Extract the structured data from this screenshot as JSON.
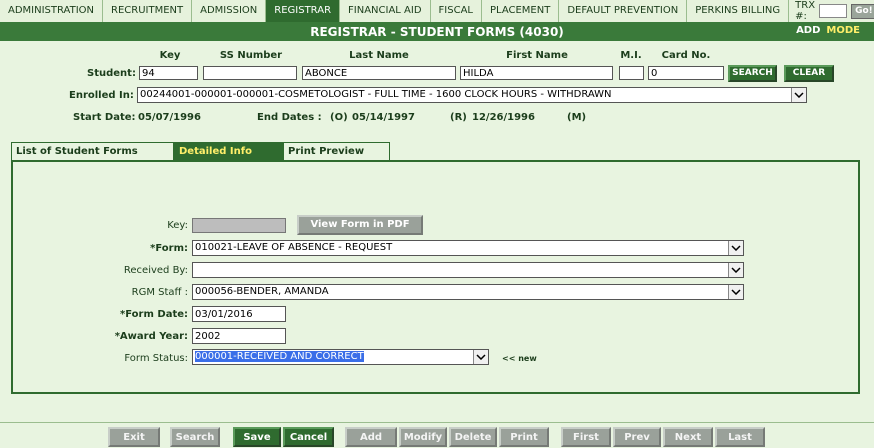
{
  "nav": {
    "items": [
      "ADMINISTRATION",
      "RECRUITMENT",
      "ADMISSION",
      "REGISTRAR",
      "FINANCIAL AID",
      "FISCAL",
      "PLACEMENT",
      "DEFAULT PREVENTION",
      "PERKINS BILLING"
    ],
    "trx_label": "TRX #:",
    "go_label": "Go!"
  },
  "title": "REGISTRAR - STUDENT FORMS (4030)",
  "mode": {
    "add": "ADD",
    "mode": "MODE"
  },
  "student": {
    "headers": {
      "key": "Key",
      "ss": "SS Number",
      "last": "Last Name",
      "first": "First Name",
      "mi": "M.I.",
      "card": "Card No."
    },
    "label": "Student:",
    "key": "94",
    "ss": "",
    "last": "ABONCE",
    "first": "HILDA",
    "mi": "",
    "card": "0",
    "search_label": "SEARCH",
    "clear_label": "CLEAR"
  },
  "enrolled": {
    "label": "Enrolled In:",
    "value": "00244001-000001-000001-COSMETOLOGIST - FULL TIME - 1600 CLOCK HOURS - WITHDRAWN"
  },
  "dates": {
    "start_label": "Start Date:",
    "start": "05/07/1996",
    "end_label": "End Dates :",
    "o_label": "(O)",
    "o": "05/14/1997",
    "r_label": "(R)",
    "r": "12/26/1996",
    "m_label": "(M)"
  },
  "tabs": [
    "List of Student Forms",
    "Detailed Info",
    "Print Preview"
  ],
  "form": {
    "key_label": "Key:",
    "view_pdf_label": "View Form in PDF",
    "form_label": "*Form:",
    "form_value": "010021-LEAVE OF ABSENCE - REQUEST",
    "received_label": "Received By:",
    "received_value": "",
    "rgm_label": "RGM Staff :",
    "rgm_value": "000056-BENDER, AMANDA",
    "form_date_label": "*Form Date:",
    "form_date_value": "03/01/2016",
    "award_label": "*Award Year:",
    "award_value": "2002",
    "status_label": "Form Status:",
    "status_value": "000001-RECEIVED AND CORRECT",
    "new_label": "<< new"
  },
  "buttons": {
    "exit": "Exit",
    "search": "Search",
    "save": "Save",
    "cancel": "Cancel",
    "add": "Add",
    "modify": "Modify",
    "delete": "Delete",
    "print": "Print",
    "first": "First",
    "prev": "Prev",
    "next": "Next",
    "last": "Last"
  }
}
